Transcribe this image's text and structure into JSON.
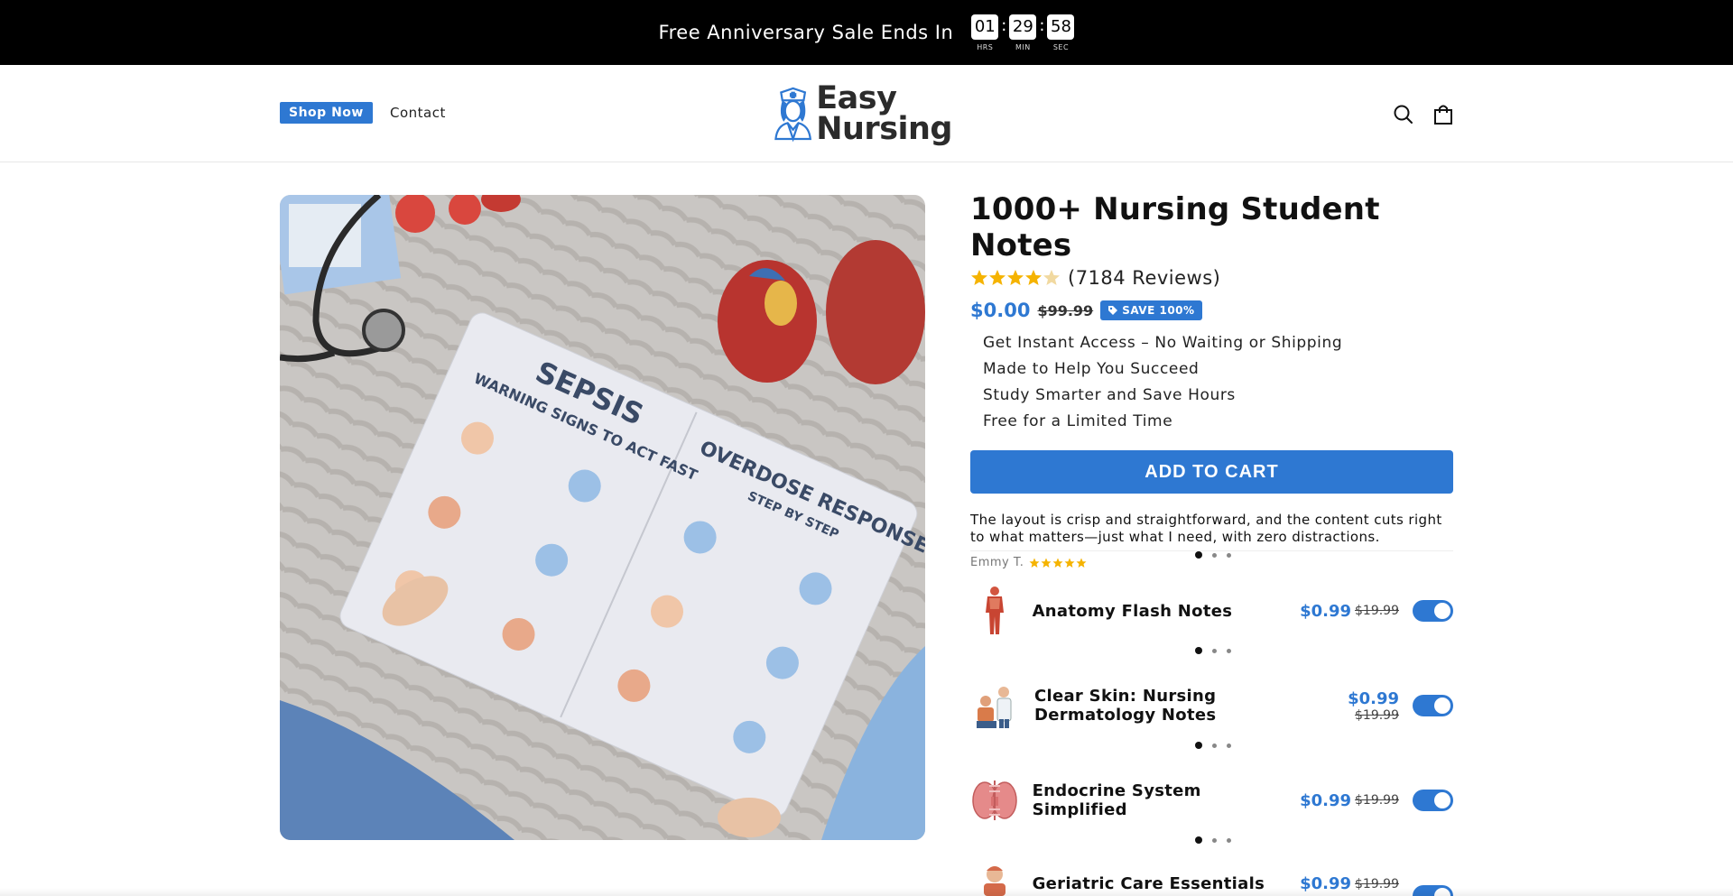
{
  "announcement": {
    "text": "Free Anniversary Sale Ends In",
    "timer": {
      "hours": "01",
      "hours_label": "HRS",
      "minutes": "29",
      "minutes_label": "MIN",
      "seconds": "58",
      "seconds_label": "SEC"
    }
  },
  "header": {
    "nav": {
      "shop_now": "Shop Now",
      "contact": "Contact"
    },
    "logo": {
      "line1": "Easy",
      "line2": "Nursing"
    },
    "icons": [
      "search-icon",
      "cart-icon"
    ]
  },
  "product": {
    "media_description_icons": [
      "stethoscope",
      "heart-model",
      "notes-sheet"
    ],
    "title": "1000+ Nursing Student Notes",
    "rating": 4.5,
    "reviews": "(7184 Reviews)",
    "price": "$0.00",
    "compare_price": "$99.99",
    "save_badge": "SAVE 100%",
    "benefits": [
      "Get Instant Access – No Waiting or Shipping",
      "Made to Help You Succeed",
      "Study Smarter and Save Hours",
      "Free for a Limited Time"
    ],
    "add_to_cart": "ADD TO CART",
    "review": {
      "text": "The layout is crisp and straightforward, and the content cuts right to what matters—just what I need, with zero distractions.",
      "author": "Emmy T.",
      "stars": 5
    }
  },
  "upsells": [
    {
      "name": "Anatomy Flash Notes",
      "price": "$0.99",
      "compare": "$19.99",
      "enabled": true,
      "icon": "anatomy-body-icon"
    },
    {
      "name": "Clear Skin: Nursing Dermatology Notes",
      "price": "$0.99",
      "compare": "$19.99",
      "enabled": true,
      "icon": "dermatology-icon"
    },
    {
      "name": "Endocrine System Simplified",
      "price": "$0.99",
      "compare": "$19.99",
      "enabled": true,
      "icon": "thyroid-icon"
    },
    {
      "name": "Geriatric Care Essentials",
      "price": "$0.99",
      "compare": "$19.99",
      "enabled": true,
      "icon": "geriatric-icon"
    }
  ],
  "colors": {
    "accent": "#2e78d2",
    "star": "#f5b300",
    "topbar": "#000000"
  }
}
